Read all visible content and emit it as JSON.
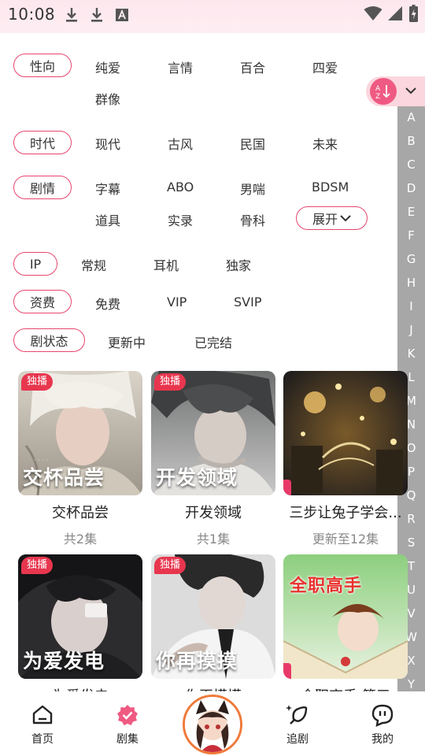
{
  "status_bar": {
    "time": "10:08"
  },
  "filters": {
    "orientation": {
      "label": "性向",
      "options": [
        "纯爱",
        "言情",
        "百合",
        "四爱",
        "群像"
      ]
    },
    "era": {
      "label": "时代",
      "options": [
        "现代",
        "古风",
        "民国",
        "未来"
      ]
    },
    "plot": {
      "label": "剧情",
      "options": [
        "字幕",
        "ABO",
        "男喘",
        "BDSM",
        "道具",
        "实录",
        "骨科"
      ],
      "expand_label": "展开"
    },
    "ip": {
      "label": "IP",
      "options": [
        "常规",
        "耳机",
        "独家"
      ]
    },
    "fee": {
      "label": "资费",
      "options": [
        "免费",
        "VIP",
        "SVIP"
      ]
    },
    "status": {
      "label": "剧状态",
      "options": [
        "更新中",
        "已完结"
      ]
    }
  },
  "alphabet": [
    "A",
    "B",
    "C",
    "D",
    "E",
    "F",
    "G",
    "H",
    "I",
    "J",
    "K",
    "L",
    "M",
    "N",
    "O",
    "P",
    "Q",
    "R",
    "S",
    "T",
    "U",
    "V",
    "W",
    "X",
    "Y"
  ],
  "cards": [
    {
      "badge": "独播",
      "cover_text": "交杯品尝",
      "title": "交杯品尝",
      "subtitle": "共2集"
    },
    {
      "badge": "独播",
      "cover_text": "开发领域",
      "title": "开发领域",
      "subtitle": "共1集"
    },
    {
      "badge": "",
      "cover_text": "",
      "title": "三步让兔子学会...",
      "subtitle": "更新至12集"
    },
    {
      "badge": "独播",
      "cover_text": "为爱发电",
      "title": "为爱发电",
      "subtitle": ""
    },
    {
      "badge": "独播",
      "cover_text": "你再摸摸",
      "title": "你再摸摸",
      "subtitle": ""
    },
    {
      "badge": "",
      "cover_text": "全职高手",
      "title": "全职高手 第三",
      "subtitle": ""
    }
  ],
  "nav": {
    "home": "首页",
    "series": "剧集",
    "follow": "追剧",
    "mine": "我的"
  },
  "colors": {
    "accent": "#e8456f",
    "badge": "#e8364e",
    "index_bg": "#a7a7a7"
  }
}
